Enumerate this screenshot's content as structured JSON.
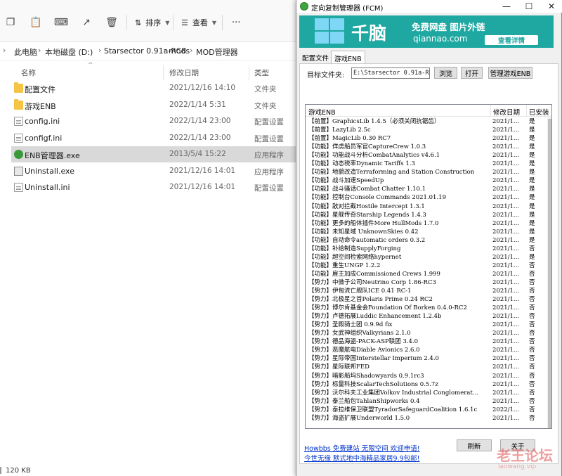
{
  "explorer": {
    "toolbar": {
      "sort_label": "排序",
      "view_label": "查看",
      "more": "···"
    },
    "breadcrumb": [
      "此电脑",
      "本地磁盘 (D:)",
      "Starsector 0.91a-RC8",
      "mods",
      "MOD管理器"
    ],
    "columns": {
      "name": "名称",
      "date": "修改日期",
      "type": "类型"
    },
    "files": [
      {
        "name": "配置文件",
        "date": "2021/12/16 14:10",
        "type": "文件夹",
        "icon": "folder-icon",
        "selected": false
      },
      {
        "name": "游戏ENB",
        "date": "2022/1/14 5:31",
        "type": "文件夹",
        "icon": "folder-icon",
        "selected": false
      },
      {
        "name": "config.ini",
        "date": "2022/1/14 23:00",
        "type": "配置设置",
        "icon": "config-file-icon",
        "selected": false
      },
      {
        "name": "configf.ini",
        "date": "2022/1/14 23:00",
        "type": "配置设置",
        "icon": "config-file-icon",
        "selected": false
      },
      {
        "name": "ENB管理器.exe",
        "date": "2013/5/4 15:22",
        "type": "应用程序",
        "icon": "app-exe-icon",
        "selected": true
      },
      {
        "name": "Uninstall.exe",
        "date": "2021/12/16 14:01",
        "type": "应用程序",
        "icon": "uninstall-exe-icon",
        "selected": false
      },
      {
        "name": "Uninstall.ini",
        "date": "2021/12/16 14:01",
        "type": "配置设置",
        "icon": "config-file-icon",
        "selected": false
      }
    ],
    "status": "120 KB"
  },
  "fcm": {
    "title": "定向复制管理器 (FCM)",
    "banner": {
      "brand": "千脑",
      "tagline": "免费网盘  图片外链",
      "domain": "qiannao.com",
      "cta": "查看详情"
    },
    "tabs": [
      "配置文件",
      "游戏ENB"
    ],
    "active_tab": 1,
    "target_label": "目标文件夹:",
    "target_value": "E:\\Starsector 0.91a-RC8\\s",
    "buttons": {
      "browse": "浏览",
      "open": "打开",
      "manage": "管理游戏ENB"
    },
    "list_headers": [
      "游戏ENB",
      "修改日期",
      "已安装"
    ],
    "items": [
      {
        "name": "【前置】GraphicsLib 1.4.5（必须关闭抗锯齿）",
        "date": "2021/1...",
        "installed": "是"
      },
      {
        "name": "【前置】LazyLib 2.5c",
        "date": "2021/1...",
        "installed": "是"
      },
      {
        "name": "【前置】MagicLib 0.30 RC7",
        "date": "2021/1...",
        "installed": "是"
      },
      {
        "name": "【功能】佯虏船员军官CaptureCrew 1.0.3",
        "date": "2021/1...",
        "installed": "是"
      },
      {
        "name": "【功能】功能战斗分析CombatAnalytics v4.6.1",
        "date": "2021/1...",
        "installed": "是"
      },
      {
        "name": "【功能】动态税率Dynamic Tariffs 1.3",
        "date": "2021/1...",
        "installed": "是"
      },
      {
        "name": "【功能】地貌改造Terraforming and Station Construction",
        "date": "2021/1...",
        "installed": "是"
      },
      {
        "name": "【功能】战斗加速SpeedUp",
        "date": "2021/1...",
        "installed": "是"
      },
      {
        "name": "【功能】战斗骚话Combat Chatter 1.10.1",
        "date": "2021/1...",
        "installed": "是"
      },
      {
        "name": "【功能】控制台Console Commands 2021.01.19",
        "date": "2021/1...",
        "installed": "是"
      },
      {
        "name": "【功能】敌对拦截Hostile Intercept 1.3.1",
        "date": "2021/1...",
        "installed": "是"
      },
      {
        "name": "【功能】星舰传奇Starship Legends 1.4.3",
        "date": "2021/1...",
        "installed": "是"
      },
      {
        "name": "【功能】更多的船体插件More HullMods 1.7.0",
        "date": "2021/1...",
        "installed": "是"
      },
      {
        "name": "【功能】未知星域 UnknownSkies 0.42",
        "date": "2021/1...",
        "installed": "是"
      },
      {
        "name": "【功能】自动命令automatic orders 0.3.2",
        "date": "2021/1...",
        "installed": "是"
      },
      {
        "name": "【功能】补给制造SupplyForging",
        "date": "2021/1...",
        "installed": "否"
      },
      {
        "name": "【功能】超空间检索网络hypernet",
        "date": "2021/1...",
        "installed": "是"
      },
      {
        "name": "【功能】重生UNGP 1.2.2",
        "date": "2021/1...",
        "installed": "否"
      },
      {
        "name": "【功能】雇主加成Commissioned Crews 1.999",
        "date": "2021/1...",
        "installed": "否"
      },
      {
        "name": "【势力】中微子公司Neutrino Corp 1.86-RC3",
        "date": "2021/1...",
        "installed": "否"
      },
      {
        "name": "【势力】伊甸流亡舰队ICE 0.41 RC-1",
        "date": "2021/1...",
        "installed": "否"
      },
      {
        "name": "【势力】北极星之首Polaris Prime 0.24 RC2",
        "date": "2021/1...",
        "installed": "否"
      },
      {
        "name": "【势力】博尔肯基金会Foundation Of Borken 0.4.0-RC2",
        "date": "2021/1...",
        "installed": "否"
      },
      {
        "name": "【势力】卢德拓展Luddic Enhancement 1.2.4b",
        "date": "2021/1...",
        "installed": "否"
      },
      {
        "name": "【势力】圣殿骑士团 0.9.9d fix",
        "date": "2021/1...",
        "installed": "否"
      },
      {
        "name": "【势力】女武神组织Valkyrians 2.1.0",
        "date": "2021/1...",
        "installed": "否"
      },
      {
        "name": "【势力】德品海盗-PACK-ASP联团 3.4.0",
        "date": "2021/1...",
        "installed": "否"
      },
      {
        "name": "【势力】恶魔航电Diable Avionics 2.6.0",
        "date": "2021/1...",
        "installed": "否"
      },
      {
        "name": "【势力】星际帝国Interstellar Imperium 2.4.0",
        "date": "2021/1...",
        "installed": "否"
      },
      {
        "name": "【势力】星际联邦FED",
        "date": "2021/1...",
        "installed": "否"
      },
      {
        "name": "【势力】暗影船坞Shadowyards 0.9.1rc3",
        "date": "2021/1...",
        "installed": "否"
      },
      {
        "name": "【势力】标量科技ScalarTechSolutions 0.5.7z",
        "date": "2021/1...",
        "installed": "否"
      },
      {
        "name": "【势力】沃尔科夫工业集团Volkov Industrial Conglomerat...",
        "date": "2021/1...",
        "installed": "否"
      },
      {
        "name": "【势力】泰兰船包TahlanShipworks 0.4",
        "date": "2021/1...",
        "installed": "否"
      },
      {
        "name": "【势力】泰拉维保卫联盟TyradorSafeguardCoalition 1.6.1c",
        "date": "2022/1...",
        "installed": "否"
      },
      {
        "name": "【势力】海盗扩展Underworld 1.5.0",
        "date": "2021/1...",
        "installed": "否"
      }
    ],
    "links": [
      "Howbbs 免费建站 无限空间 欢迎申请!",
      "今世无缘 默式地中海精品家居9.9包邮!"
    ],
    "buttons_bottom": {
      "refresh": "刷新",
      "about": "关于"
    }
  },
  "watermark": {
    "line1": "老王论坛",
    "line2": "laowang.vip"
  }
}
